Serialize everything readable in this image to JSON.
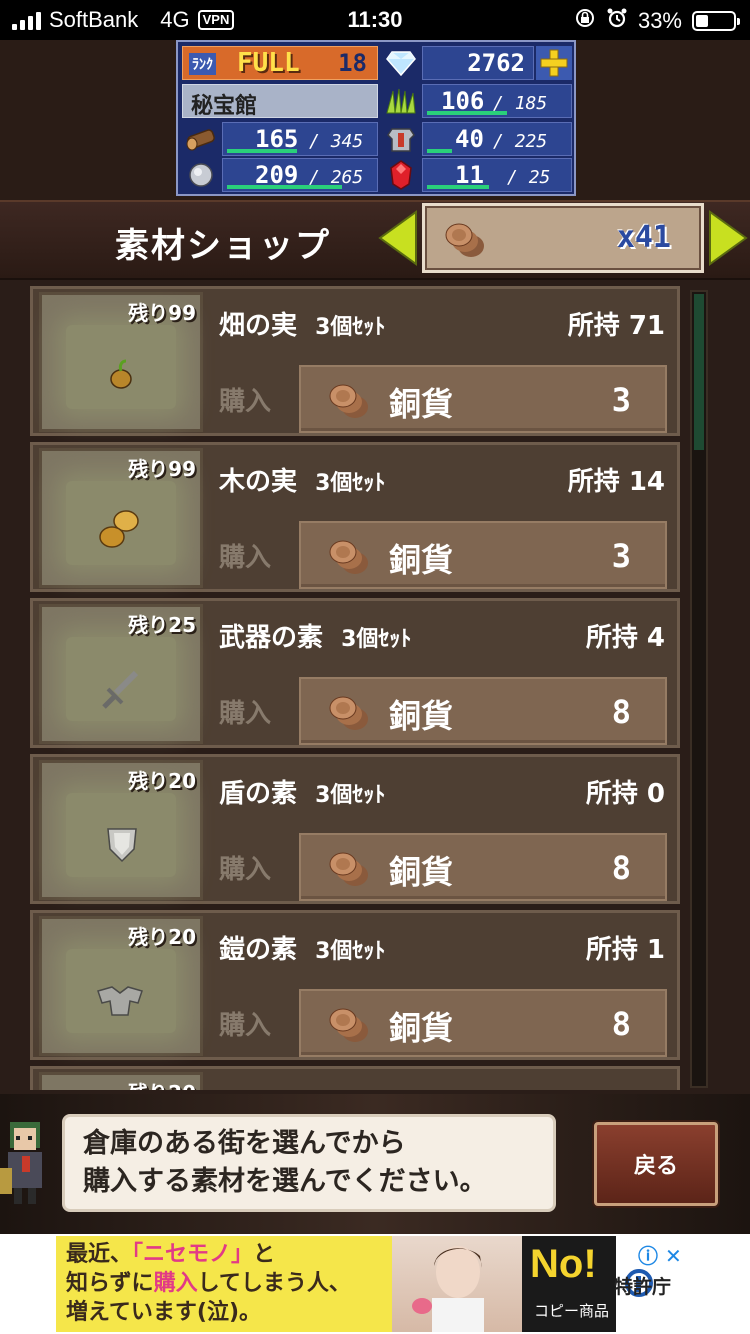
{
  "status_bar": {
    "carrier": "SoftBank",
    "network": "4G",
    "vpn": "VPN",
    "time": "11:30",
    "battery": "33%",
    "battery_level": 0.33
  },
  "stats": {
    "rank_label": "ﾗﾝｸ",
    "rank_status": "FULL",
    "rank_value": "18",
    "gems": "2762",
    "location": "秘宝館",
    "grass": {
      "value": "106",
      "max": "185",
      "fill": 0.57
    },
    "wood": {
      "value": "165",
      "max": "345",
      "fill": 0.48
    },
    "armor": {
      "value": "40",
      "max": "225",
      "fill": 0.18
    },
    "stone": {
      "value": "209",
      "max": "265",
      "fill": 0.79
    },
    "ruby": {
      "value": "11",
      "max": "25",
      "fill": 0.44
    }
  },
  "header": {
    "title": "素材ショップ",
    "currency_count": "x41"
  },
  "items": [
    {
      "remaining": "残り99",
      "name": "畑の実",
      "set": "3個ｾｯﾄ",
      "owned": "所持 71",
      "buy": "購入",
      "currency": "銅貨",
      "price": "3",
      "icon": "seed-icon"
    },
    {
      "remaining": "残り99",
      "name": "木の実",
      "set": "3個ｾｯﾄ",
      "owned": "所持 14",
      "buy": "購入",
      "currency": "銅貨",
      "price": "3",
      "icon": "nut-icon"
    },
    {
      "remaining": "残り25",
      "name": "武器の素",
      "set": "3個ｾｯﾄ",
      "owned": "所持 4",
      "buy": "購入",
      "currency": "銅貨",
      "price": "8",
      "icon": "sword-icon"
    },
    {
      "remaining": "残り20",
      "name": "盾の素",
      "set": "3個ｾｯﾄ",
      "owned": "所持 0",
      "buy": "購入",
      "currency": "銅貨",
      "price": "8",
      "icon": "shield-icon"
    },
    {
      "remaining": "残り20",
      "name": "鎧の素",
      "set": "3個ｾｯﾄ",
      "owned": "所持 1",
      "buy": "購入",
      "currency": "銅貨",
      "price": "8",
      "icon": "armor-icon"
    },
    {
      "remaining": "残り20",
      "name": "",
      "set": "",
      "owned": "",
      "buy": "",
      "currency": "",
      "price": "",
      "icon": ""
    }
  ],
  "message": {
    "line1": "倉庫のある街を選んでから",
    "line2": "購入する素材を選んでください。"
  },
  "back_button": "戻る",
  "ad": {
    "line1a": "最近、",
    "line1b": "「ニセモノ」",
    "line1c": "と",
    "line2a": "知らずに",
    "line2b": "購入",
    "line2c": "してしまう人、",
    "line3": "増えています(泣)。",
    "no_text": "No!",
    "no_sub": "コピー商品",
    "org": "特許庁"
  }
}
